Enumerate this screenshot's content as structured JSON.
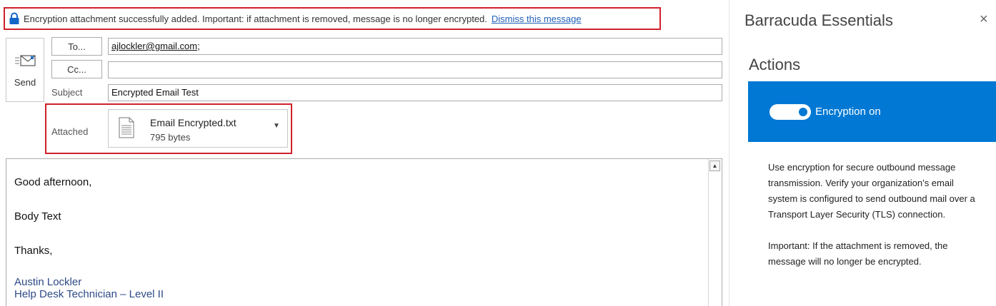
{
  "infobar": {
    "message": "Encryption attachment successfully added. Important: if attachment is removed, message is no longer encrypted.",
    "dismiss_label": "Dismiss this message"
  },
  "compose": {
    "send_label": "Send",
    "to_label": "To...",
    "cc_label": "Cc...",
    "subject_label": "Subject",
    "attached_label": "Attached",
    "to_value": "ajlockler@gmail.com;",
    "cc_value": "",
    "subject_value": "Encrypted Email Test",
    "attachment": {
      "name": "Email Encrypted.txt",
      "size": "795 bytes"
    }
  },
  "body": {
    "greeting": "Good afternoon,",
    "text": "Body Text",
    "closing": "Thanks,",
    "signature_name": "Austin Lockler",
    "signature_title": "Help Desk Technician – Level II"
  },
  "panel": {
    "title": "Barracuda Essentials",
    "close_glyph": "×",
    "actions_heading": "Actions",
    "encryption_label": "Encryption on",
    "encryption_on": true,
    "description_1": "Use encryption for secure outbound message transmission. Verify your organization’s email system is configured to send outbound mail over a Transport Layer Security (TLS) connection.",
    "description_2": "Important: If the attachment is removed, the message will no longer be encrypted."
  },
  "colors": {
    "accent": "#0078d4",
    "highlight_border": "#d0202b",
    "signature": "#2e4a86",
    "link": "#1f5fb8"
  },
  "icons": {
    "lock": "lock-icon",
    "send": "send-icon",
    "file": "file-icon",
    "caret": "chevron-down-icon"
  }
}
